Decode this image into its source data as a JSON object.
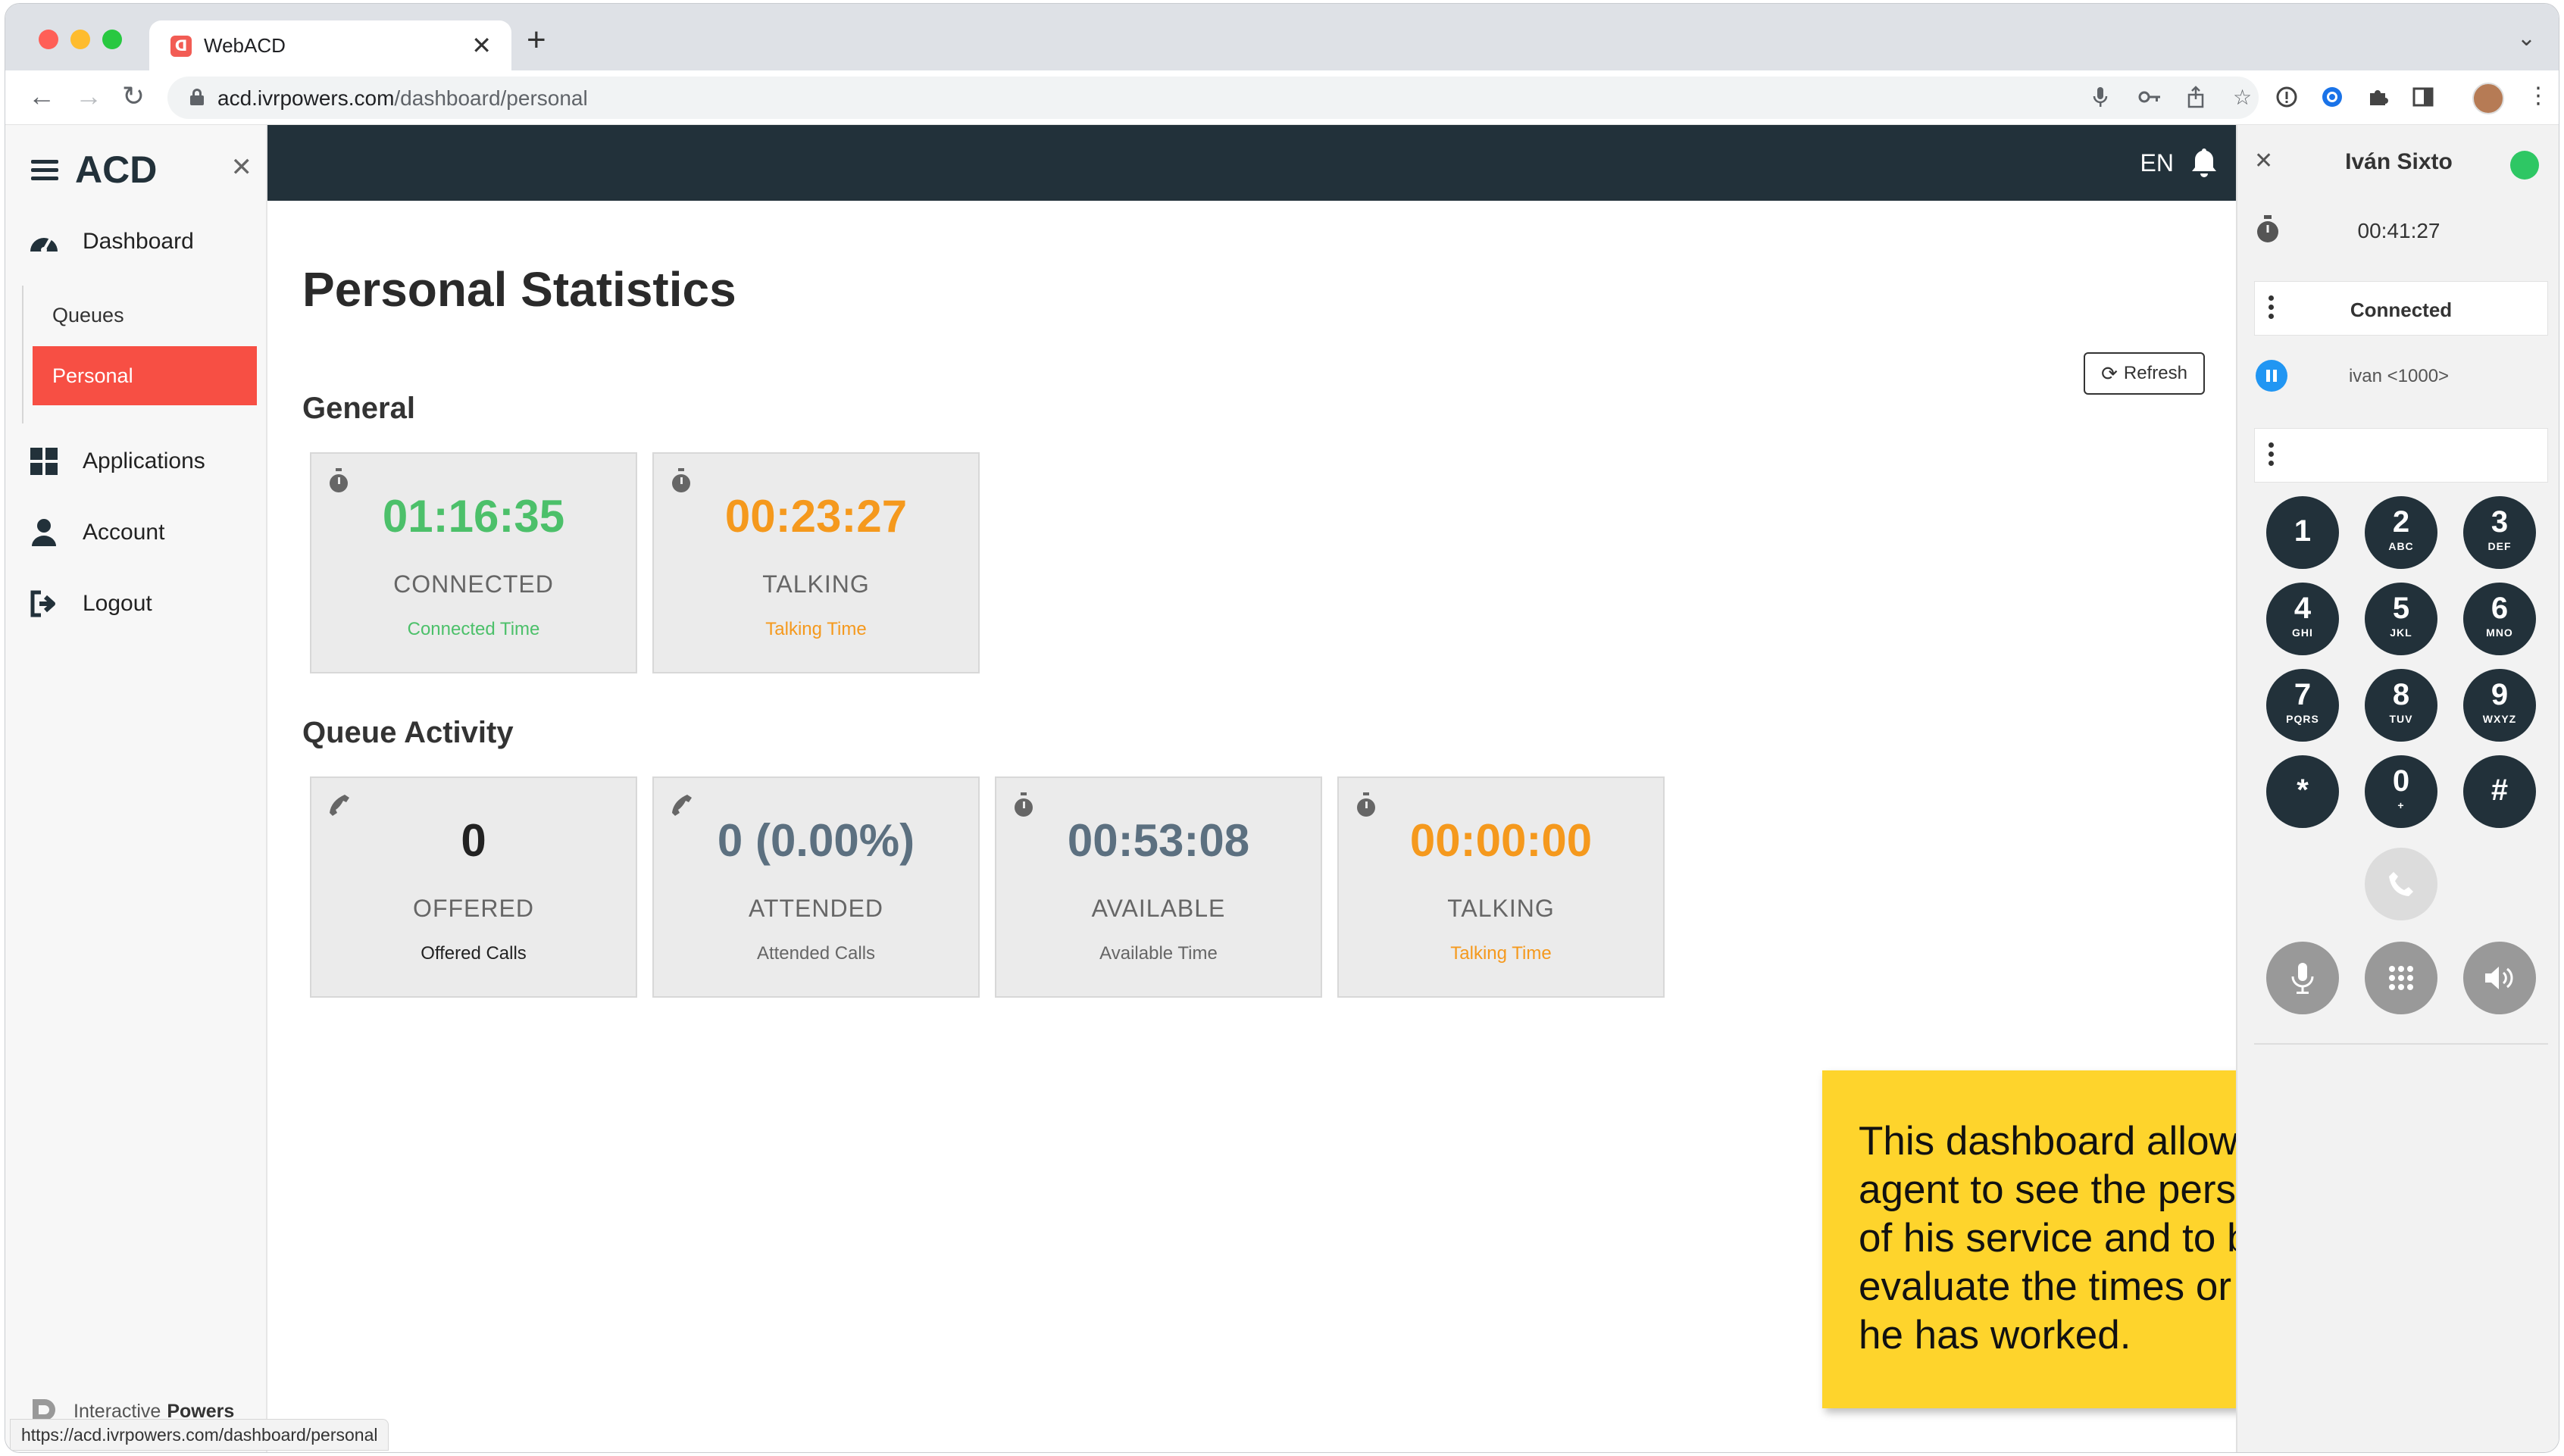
{
  "browser": {
    "tab_title": "WebACD",
    "tab_close": "✕",
    "new_tab": "+",
    "url_host": "acd.ivrpowers.com",
    "url_path": "/dashboard/personal",
    "status_url": "https://acd.ivrpowers.com/dashboard/personal"
  },
  "sidebar": {
    "logo": "ACD",
    "close": "✕",
    "items": [
      {
        "label": "Dashboard",
        "icon": "dashboard-gauge-icon"
      },
      {
        "label": "Applications",
        "icon": "grid-icon"
      },
      {
        "label": "Account",
        "icon": "user-icon"
      },
      {
        "label": "Logout",
        "icon": "logout-icon"
      }
    ],
    "sub_items": [
      {
        "label": "Queues",
        "active": false
      },
      {
        "label": "Personal",
        "active": true
      }
    ],
    "brand_light": "Interactive",
    "brand_bold": "Powers"
  },
  "topbar": {
    "language": "EN"
  },
  "main": {
    "title": "Personal Statistics",
    "refresh_label": "Refresh",
    "general": {
      "title": "General",
      "cards": [
        {
          "icon": "stopwatch-icon",
          "value": "01:16:35",
          "label": "CONNECTED",
          "sub": "Connected Time",
          "color": "#4cc06a"
        },
        {
          "icon": "stopwatch-icon",
          "value": "00:23:27",
          "label": "TALKING",
          "sub": "Talking Time",
          "color": "#f5991d"
        }
      ]
    },
    "queue": {
      "title": "Queue Activity",
      "cards": [
        {
          "icon": "phone-icon",
          "value": "0",
          "label": "OFFERED",
          "sub": "Offered Calls"
        },
        {
          "icon": "phone-icon",
          "value": "0 (0.00%)",
          "label": "ATTENDED",
          "sub": "Attended Calls"
        },
        {
          "icon": "stopwatch-icon",
          "value": "00:53:08",
          "label": "AVAILABLE",
          "sub": "Available Time"
        },
        {
          "icon": "stopwatch-icon",
          "value": "00:00:00",
          "label": "TALKING",
          "sub": "Talking Time",
          "color": "#f5991d"
        }
      ]
    },
    "note": "This dashboard allows the agent to see the personal data of his service and to be able to evaluate the times or video calls he has worked."
  },
  "phone": {
    "agent_name": "Iván Sixto",
    "status_color": "#2ec764",
    "timer": "00:41:27",
    "state": "Connected",
    "line": "ivan <1000>",
    "dial_input": "",
    "keys": [
      {
        "digit": "1",
        "letters": ""
      },
      {
        "digit": "2",
        "letters": "ABC"
      },
      {
        "digit": "3",
        "letters": "DEF"
      },
      {
        "digit": "4",
        "letters": "GHI"
      },
      {
        "digit": "5",
        "letters": "JKL"
      },
      {
        "digit": "6",
        "letters": "MNO"
      },
      {
        "digit": "7",
        "letters": "PQRS"
      },
      {
        "digit": "8",
        "letters": "TUV"
      },
      {
        "digit": "9",
        "letters": "WXYZ"
      },
      {
        "digit": "*",
        "letters": ""
      },
      {
        "digit": "0",
        "letters": "+"
      },
      {
        "digit": "#",
        "letters": ""
      }
    ]
  }
}
